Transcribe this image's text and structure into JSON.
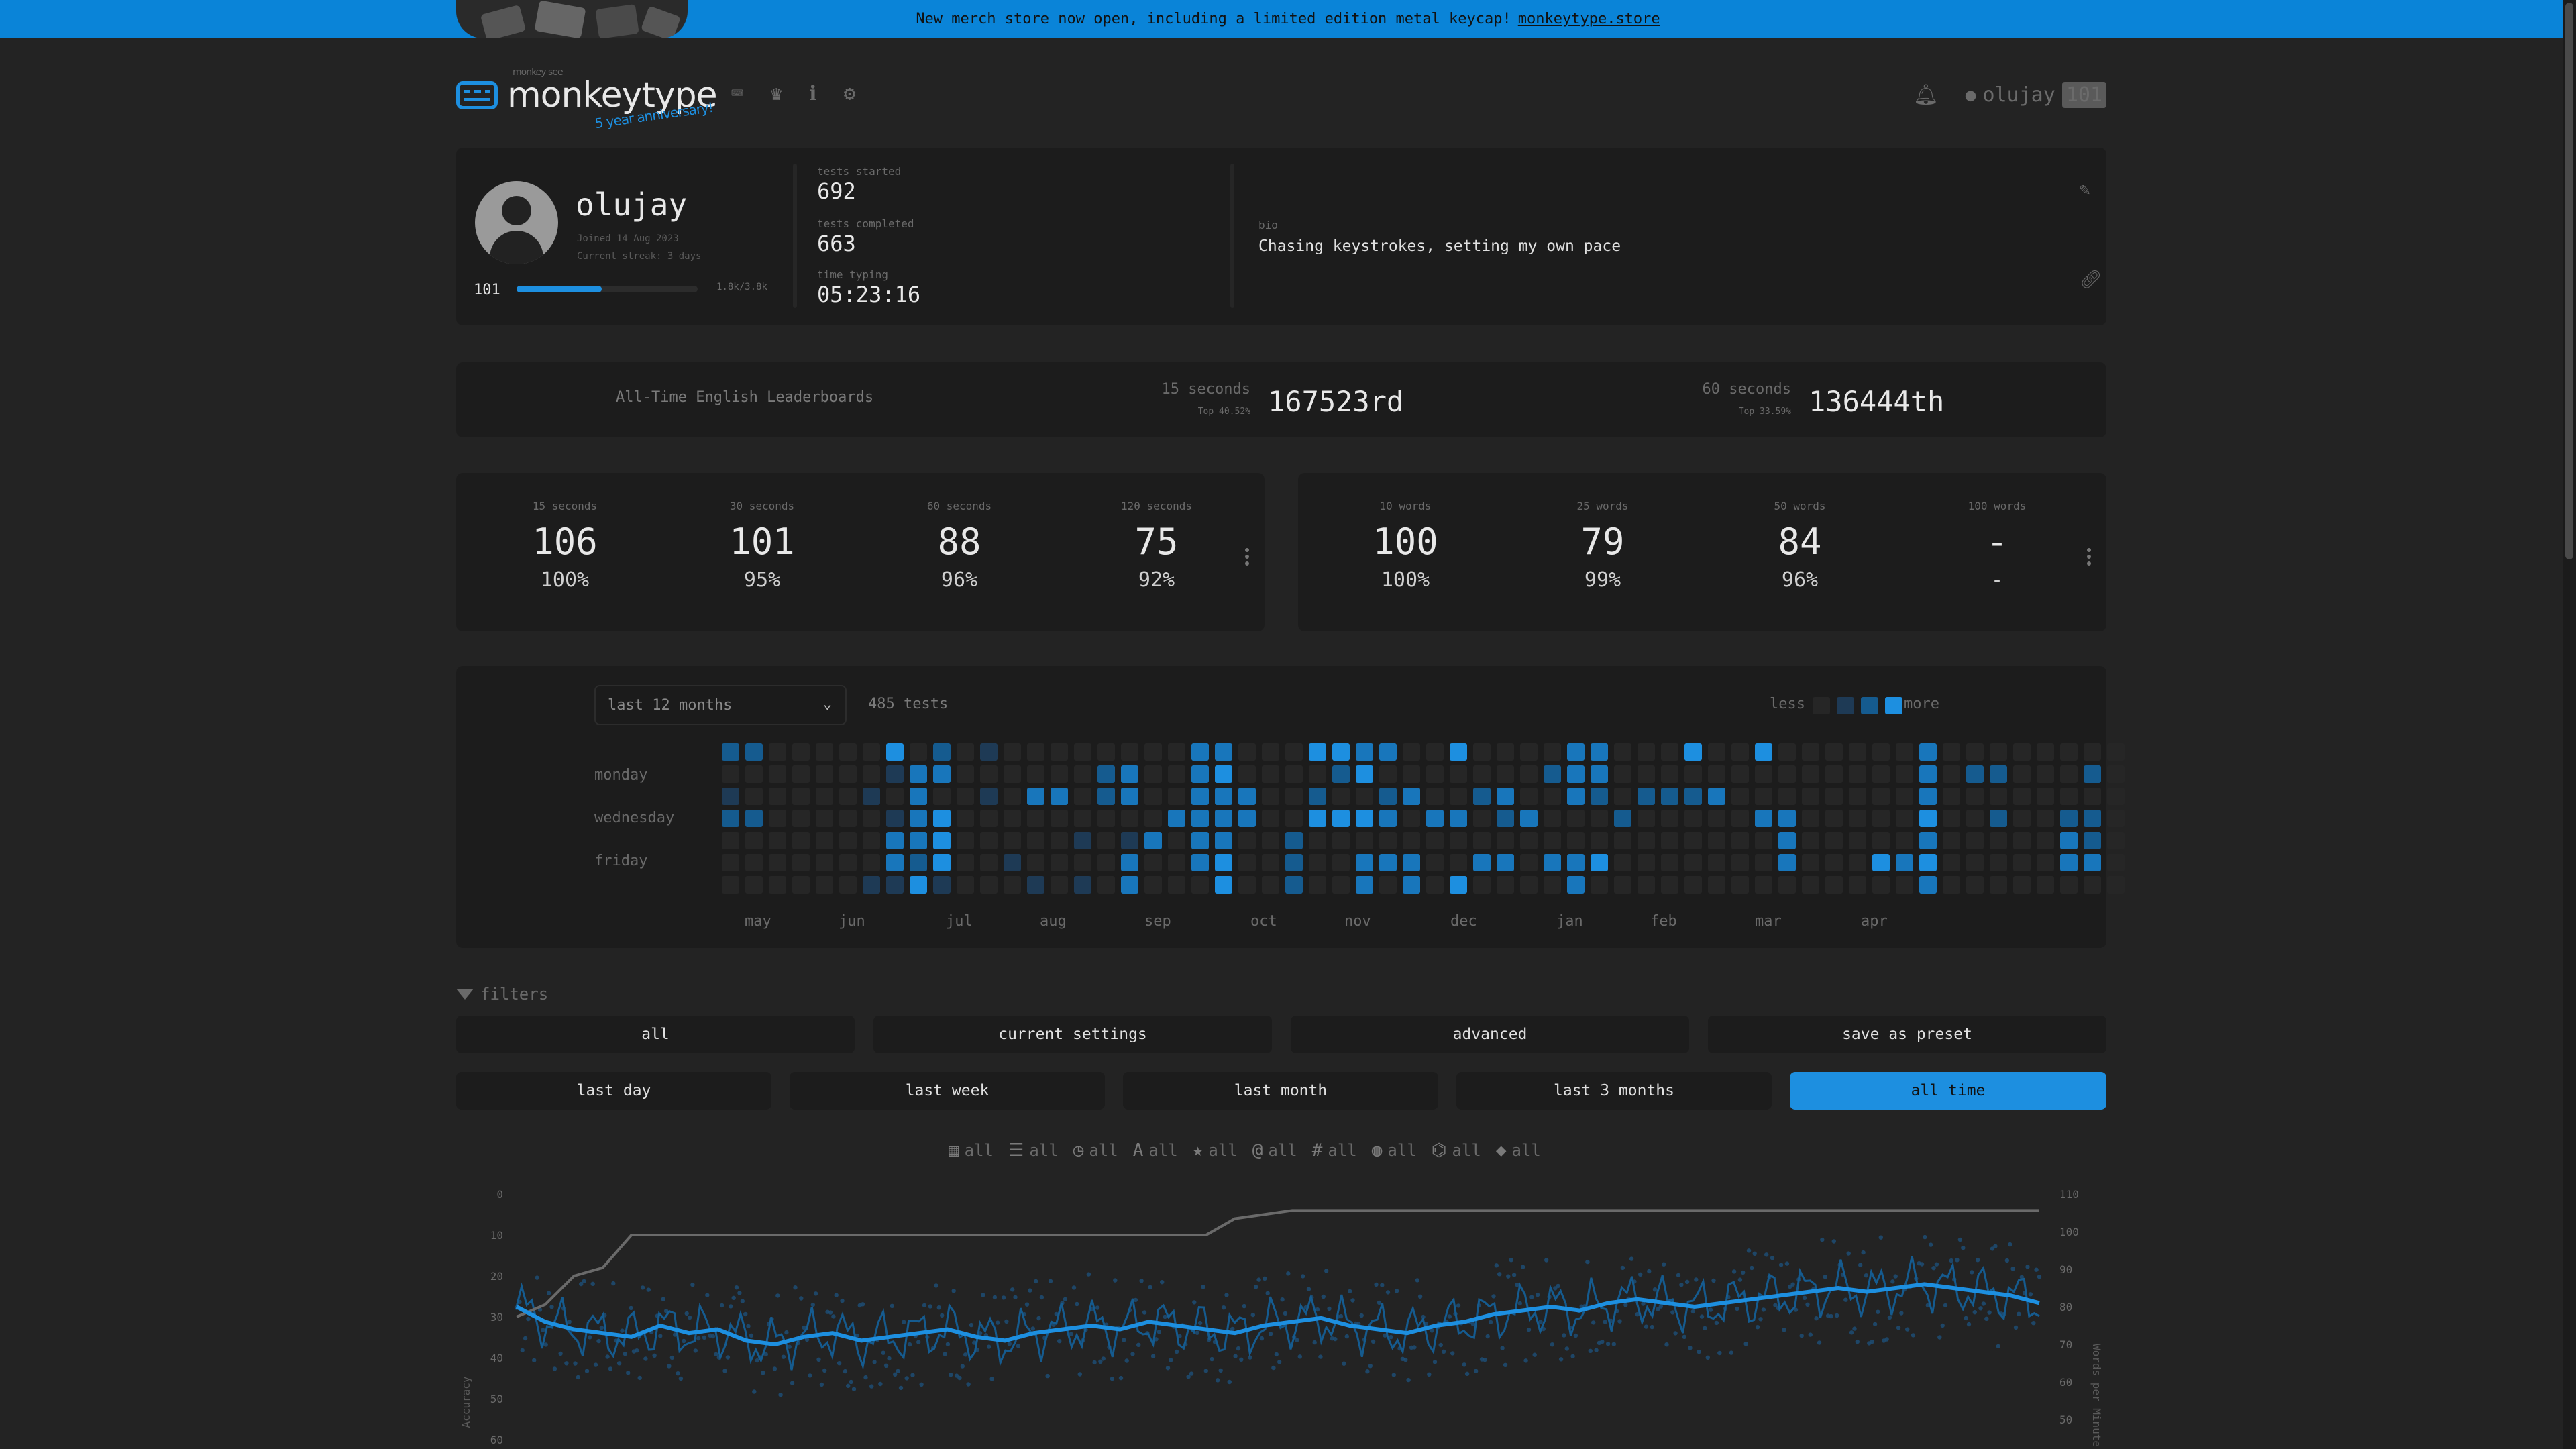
{
  "banner": {
    "text": "New merch store now open, including a limited edition metal keycap!",
    "link": "monkeytype.store"
  },
  "nav": {
    "logo_sub": "monkey see",
    "logo_title": "monkeytype",
    "anniversary": "5 year anniversary!",
    "icons": [
      "keyboard-icon",
      "crown-icon",
      "info-icon",
      "gear-icon"
    ],
    "account_name": "olujay",
    "account_level": "101"
  },
  "profile": {
    "username": "olujay",
    "joined": "Joined 14 Aug 2023",
    "streak": "Current streak: 3 days",
    "level": "101",
    "xp_text": "1.8k/3.8k",
    "xp_fraction": 0.47,
    "tests_started_label": "tests started",
    "tests_started": "692",
    "tests_completed_label": "tests completed",
    "tests_completed": "663",
    "time_typing_label": "time typing",
    "time_typing": "05:23:16",
    "bio_label": "bio",
    "bio": "Chasing keystrokes, setting my own pace"
  },
  "leaderboards": {
    "title": "All-Time English Leaderboards",
    "entries": [
      {
        "label": "15 seconds",
        "sub": "Top 40.52%",
        "rank": "167523rd"
      },
      {
        "label": "60 seconds",
        "sub": "Top 33.59%",
        "rank": "136444th"
      }
    ]
  },
  "personal_bests": {
    "time": [
      {
        "label": "15 seconds",
        "wpm": "106",
        "acc": "100%"
      },
      {
        "label": "30 seconds",
        "wpm": "101",
        "acc": "95%"
      },
      {
        "label": "60 seconds",
        "wpm": "88",
        "acc": "96%"
      },
      {
        "label": "120 seconds",
        "wpm": "75",
        "acc": "92%"
      }
    ],
    "words": [
      {
        "label": "10 words",
        "wpm": "100",
        "acc": "100%"
      },
      {
        "label": "25 words",
        "wpm": "79",
        "acc": "99%"
      },
      {
        "label": "50 words",
        "wpm": "84",
        "acc": "96%"
      },
      {
        "label": "100 words",
        "wpm": "-",
        "acc": "-"
      }
    ]
  },
  "activity": {
    "range_select": "last 12 months",
    "tests": "485 tests",
    "legend_less": "less",
    "legend_more": "more",
    "day_labels": [
      "monday",
      "wednesday",
      "friday"
    ],
    "months": [
      "may",
      "jun",
      "jul",
      "aug",
      "sep",
      "oct",
      "nov",
      "dec",
      "jan",
      "feb",
      "mar",
      "apr"
    ],
    "colors": [
      "#262626",
      "#1e3a55",
      "#155b8f",
      "#1876bb",
      "#1d8fe0"
    ],
    "weeks": [
      [
        2,
        0,
        1,
        2,
        0,
        0,
        0
      ],
      [
        2,
        0,
        0,
        2,
        0,
        0,
        0
      ],
      [
        0,
        0,
        0,
        0,
        0,
        0,
        0
      ],
      [
        0,
        0,
        0,
        0,
        0,
        0,
        0
      ],
      [
        0,
        0,
        0,
        0,
        0,
        0,
        0
      ],
      [
        0,
        0,
        0,
        0,
        0,
        0,
        0
      ],
      [
        0,
        0,
        1,
        0,
        0,
        0,
        1
      ],
      [
        4,
        1,
        0,
        1,
        3,
        3,
        1
      ],
      [
        0,
        3,
        3,
        3,
        3,
        2,
        4
      ],
      [
        2,
        3,
        0,
        4,
        4,
        4,
        1
      ],
      [
        0,
        0,
        0,
        0,
        0,
        0,
        0
      ],
      [
        1,
        0,
        1,
        0,
        0,
        0,
        0
      ],
      [
        0,
        0,
        0,
        0,
        0,
        1,
        0
      ],
      [
        0,
        0,
        3,
        0,
        0,
        0,
        1
      ],
      [
        0,
        0,
        3,
        0,
        0,
        0,
        0
      ],
      [
        0,
        0,
        0,
        0,
        1,
        0,
        1
      ],
      [
        0,
        2,
        2,
        0,
        0,
        0,
        0
      ],
      [
        0,
        3,
        3,
        0,
        1,
        3,
        3
      ],
      [
        0,
        0,
        0,
        0,
        3,
        0,
        0
      ],
      [
        0,
        0,
        0,
        3,
        0,
        0,
        0
      ],
      [
        3,
        3,
        3,
        3,
        3,
        3,
        0
      ],
      [
        3,
        4,
        3,
        3,
        3,
        4,
        4
      ],
      [
        0,
        0,
        3,
        3,
        0,
        0,
        0
      ],
      [
        0,
        0,
        0,
        0,
        0,
        0,
        0
      ],
      [
        0,
        0,
        0,
        0,
        2,
        2,
        2
      ],
      [
        4,
        0,
        2,
        4,
        0,
        0,
        0
      ],
      [
        4,
        2,
        0,
        4,
        0,
        0,
        0
      ],
      [
        3,
        4,
        0,
        4,
        0,
        3,
        3
      ],
      [
        3,
        0,
        2,
        3,
        0,
        3,
        0
      ],
      [
        0,
        0,
        3,
        0,
        0,
        3,
        3
      ],
      [
        0,
        0,
        0,
        3,
        0,
        0,
        0
      ],
      [
        4,
        0,
        0,
        3,
        0,
        0,
        4
      ],
      [
        0,
        0,
        2,
        0,
        0,
        3,
        0
      ],
      [
        0,
        0,
        3,
        2,
        0,
        3,
        0
      ],
      [
        0,
        0,
        0,
        3,
        0,
        0,
        0
      ],
      [
        0,
        2,
        0,
        0,
        0,
        3,
        0
      ],
      [
        3,
        3,
        3,
        0,
        0,
        3,
        3
      ],
      [
        3,
        3,
        2,
        0,
        0,
        4,
        0
      ],
      [
        0,
        0,
        0,
        2,
        0,
        0,
        0
      ],
      [
        0,
        0,
        2,
        0,
        0,
        0,
        0
      ],
      [
        0,
        0,
        2,
        0,
        0,
        0,
        0
      ],
      [
        4,
        0,
        2,
        0,
        0,
        0,
        0
      ],
      [
        0,
        0,
        3,
        0,
        0,
        0,
        0
      ],
      [
        0,
        0,
        0,
        0,
        0,
        0,
        0
      ],
      [
        4,
        0,
        0,
        3,
        0,
        0,
        0
      ],
      [
        0,
        0,
        0,
        3,
        3,
        3,
        0
      ],
      [
        0,
        0,
        0,
        0,
        0,
        0,
        0
      ],
      [
        0,
        0,
        0,
        0,
        0,
        0,
        0
      ],
      [
        0,
        0,
        0,
        0,
        0,
        0,
        0
      ],
      [
        0,
        0,
        0,
        0,
        0,
        4,
        0
      ],
      [
        0,
        0,
        0,
        0,
        0,
        3,
        0
      ],
      [
        3,
        3,
        3,
        4,
        3,
        4,
        3
      ],
      [
        0,
        0,
        0,
        0,
        0,
        0,
        0
      ],
      [
        0,
        2,
        0,
        0,
        0,
        0,
        0
      ],
      [
        0,
        2,
        0,
        2,
        0,
        0,
        0
      ],
      [
        0,
        0,
        0,
        0,
        0,
        0,
        0
      ],
      [
        0,
        0,
        0,
        0,
        0,
        0,
        0
      ],
      [
        0,
        0,
        0,
        2,
        3,
        3,
        0
      ],
      [
        0,
        2,
        0,
        2,
        2,
        3,
        0
      ],
      [
        0,
        0,
        0,
        0,
        0,
        0,
        0
      ]
    ]
  },
  "filters": {
    "label": "filters",
    "presets": [
      "all",
      "current settings",
      "advanced",
      "save as preset"
    ],
    "ranges": [
      "last day",
      "last week",
      "last month",
      "last 3 months",
      "all time"
    ],
    "active_range": "all time",
    "chips": [
      {
        "icon": "calendar-icon",
        "glyph": "▦",
        "label": "all"
      },
      {
        "icon": "list-icon",
        "glyph": "☰",
        "label": "all"
      },
      {
        "icon": "clock-icon",
        "glyph": "◷",
        "label": "all"
      },
      {
        "icon": "font-icon",
        "glyph": "A",
        "label": "all"
      },
      {
        "icon": "star-icon",
        "glyph": "★",
        "label": "all"
      },
      {
        "icon": "at-icon",
        "glyph": "@",
        "label": "all"
      },
      {
        "icon": "hash-icon",
        "glyph": "#",
        "label": "all"
      },
      {
        "icon": "globe-icon",
        "glyph": "◍",
        "label": "all"
      },
      {
        "icon": "gamepad-icon",
        "glyph": "⌬",
        "label": "all"
      },
      {
        "icon": "tag-icon",
        "glyph": "◆",
        "label": "all"
      }
    ]
  },
  "chart_data": {
    "type": "line",
    "ylabel_left": "Accuracy",
    "ylabel_right": "Words per Minute",
    "left_ticks": [
      "0",
      "10",
      "20",
      "30",
      "40",
      "50",
      "60"
    ],
    "right_ticks": [
      "110",
      "100",
      "90",
      "80",
      "70",
      "60",
      "50"
    ],
    "series": [
      {
        "values": [
          80,
          76,
          74,
          73,
          72,
          75,
          73,
          74,
          71,
          70,
          72,
          73,
          71,
          72,
          73,
          74,
          72,
          71,
          73,
          74,
          75,
          74,
          76,
          75,
          74,
          73,
          75,
          76,
          77,
          75,
          74,
          73,
          75,
          76,
          78,
          79,
          80,
          79,
          81,
          82,
          81,
          80,
          81,
          82,
          83,
          84,
          85,
          84,
          85,
          86,
          85,
          84,
          83,
          81
        ]
      },
      {
        "values": [
          30,
          27,
          20,
          18,
          10,
          10,
          10,
          10,
          10,
          10,
          10,
          10,
          10,
          10,
          10,
          10,
          10,
          10,
          10,
          10,
          10,
          10,
          10,
          10,
          10,
          6,
          5,
          4,
          4,
          4,
          4,
          4,
          4,
          4,
          4,
          4,
          4,
          4,
          4,
          4,
          4,
          4,
          4,
          4,
          4,
          4,
          4,
          4,
          4,
          4,
          4,
          4,
          4,
          4
        ]
      }
    ]
  }
}
